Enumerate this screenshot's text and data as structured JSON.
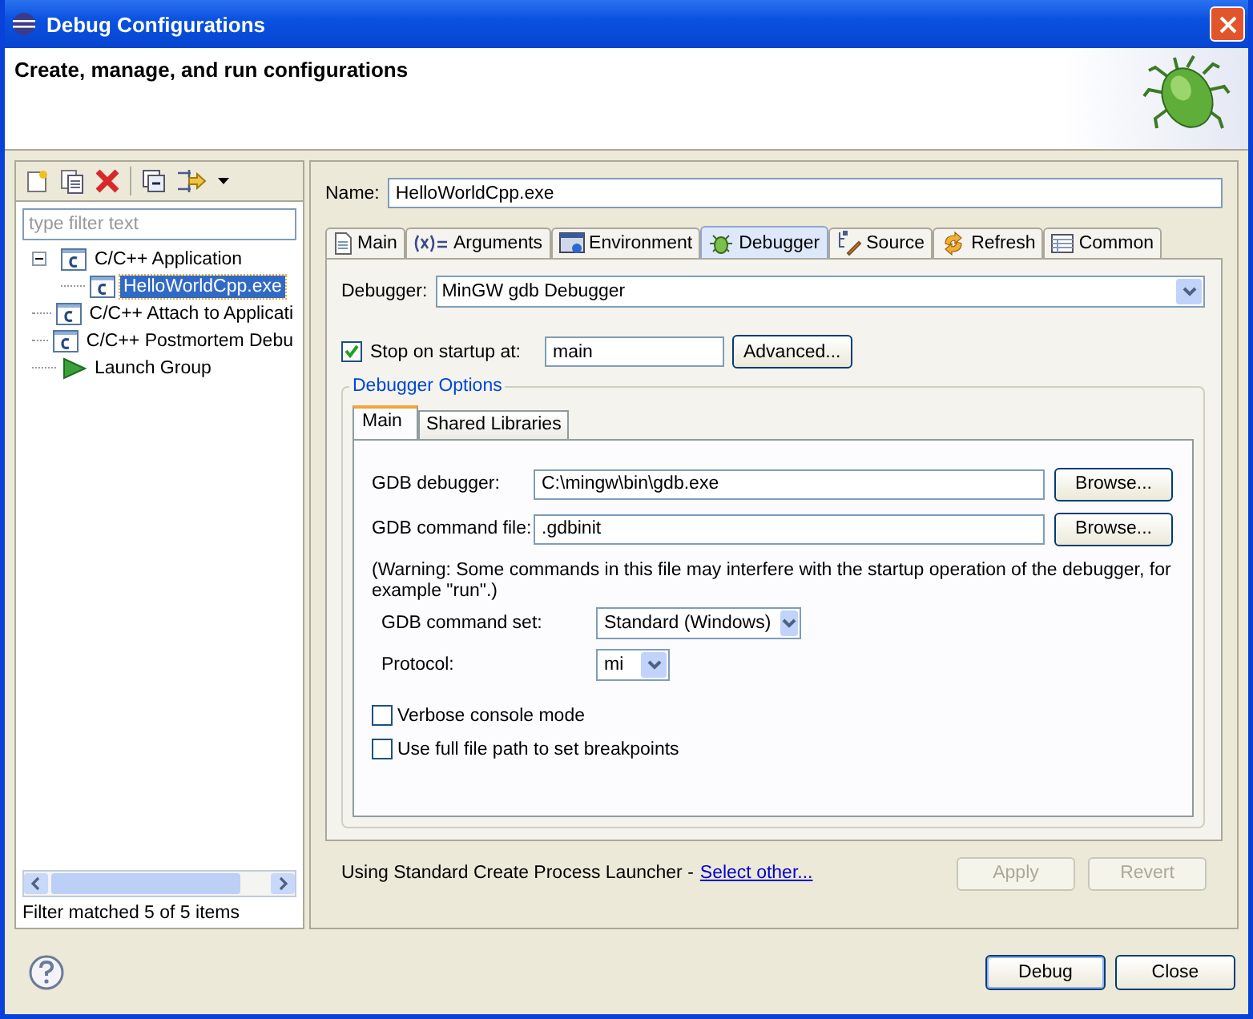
{
  "window": {
    "title": "Debug Configurations"
  },
  "header": {
    "title": "Create, manage, and run configurations"
  },
  "sidebar": {
    "filter": {
      "placeholder": "type filter text"
    },
    "tree": [
      {
        "label": "C/C++ Application",
        "kind": "config",
        "expanded": true,
        "selected": false,
        "children": [
          {
            "label": "HelloWorldCpp.exe",
            "kind": "config",
            "selected": true
          }
        ]
      },
      {
        "label": "C/C++ Attach to Applicati",
        "kind": "config",
        "selected": false
      },
      {
        "label": "C/C++ Postmortem Debu",
        "kind": "config",
        "selected": false
      },
      {
        "label": "Launch Group",
        "kind": "launch-group",
        "selected": false
      }
    ],
    "status": "Filter matched 5 of 5 items"
  },
  "config": {
    "name_label": "Name:",
    "name": "HelloWorldCpp.exe",
    "tabs": [
      {
        "label": "Main",
        "selected": false
      },
      {
        "label": "Arguments",
        "selected": false
      },
      {
        "label": "Environment",
        "selected": false
      },
      {
        "label": "Debugger",
        "selected": true
      },
      {
        "label": "Source",
        "selected": false
      },
      {
        "label": "Refresh",
        "selected": false
      },
      {
        "label": "Common",
        "selected": false
      }
    ],
    "debugger_label": "Debugger:",
    "debugger": "MinGW gdb Debugger",
    "stop_on_startup": {
      "label": "Stop on startup at:",
      "checked": true,
      "value": "main"
    },
    "advanced_button": "Advanced...",
    "options": {
      "title": "Debugger Options",
      "tabs": [
        {
          "label": "Main",
          "selected": true
        },
        {
          "label": "Shared Libraries",
          "selected": false
        }
      ],
      "fields": [
        {
          "label": "GDB debugger:",
          "value": "C:\\mingw\\bin\\gdb.exe",
          "button": "Browse..."
        },
        {
          "label": "GDB command file:",
          "value": ".gdbinit",
          "button": "Browse..."
        }
      ],
      "warning": "(Warning: Some commands in this file may interfere with the startup operation of the debugger, for example \"run\".)",
      "selects": [
        {
          "label": "GDB command set:",
          "value": "Standard (Windows)"
        },
        {
          "label": "Protocol:",
          "value": "mi"
        }
      ],
      "checkboxes": [
        {
          "label": "Verbose console mode",
          "checked": false
        },
        {
          "label": "Use full file path to set breakpoints",
          "checked": false
        }
      ]
    },
    "launcher": {
      "text": "Using Standard Create Process Launcher -",
      "link": "Select other..."
    },
    "buttons": [
      {
        "label": "Apply",
        "disabled": true
      },
      {
        "label": "Revert",
        "disabled": true
      }
    ]
  },
  "footer": {
    "buttons": [
      {
        "label": "Debug",
        "default": true
      },
      {
        "label": "Close",
        "default": false
      }
    ]
  }
}
